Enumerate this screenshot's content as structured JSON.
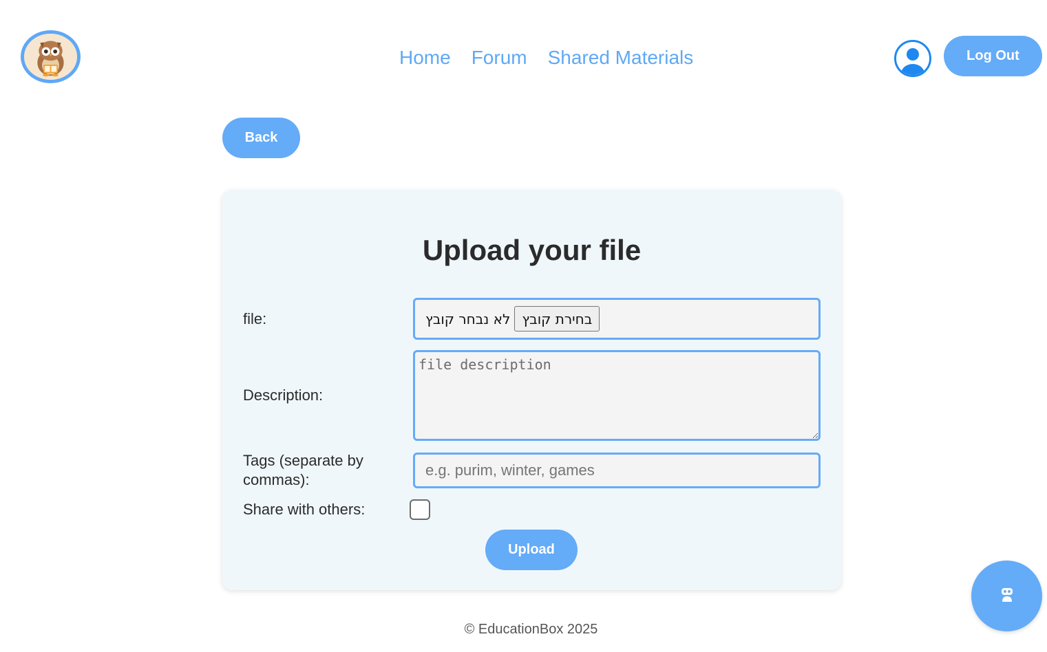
{
  "header": {
    "nav": [
      {
        "label": "Home"
      },
      {
        "label": "Forum"
      },
      {
        "label": "Shared Materials"
      }
    ],
    "logout_label": "Log Out"
  },
  "back_label": "Back",
  "form": {
    "title": "Upload your file",
    "file_label": "file:",
    "file_choose_label": "בחירת קובץ",
    "file_status": "לא נבחר קובץ",
    "description_label": "Description:",
    "description_placeholder": "file description",
    "tags_label": "Tags (separate by commas):",
    "tags_placeholder": "e.g. purim, winter, games",
    "share_label": "Share with others:",
    "share_checked": false,
    "upload_label": "Upload"
  },
  "footer": {
    "text": "© EducationBox 2025"
  },
  "colors": {
    "accent": "#64abf8",
    "card_bg": "#f0f7fb",
    "field_bg": "#f4f4f4"
  },
  "icons": {
    "logo": "owl-logo-icon",
    "profile": "user-profile-icon",
    "chat": "robot-chat-icon"
  }
}
